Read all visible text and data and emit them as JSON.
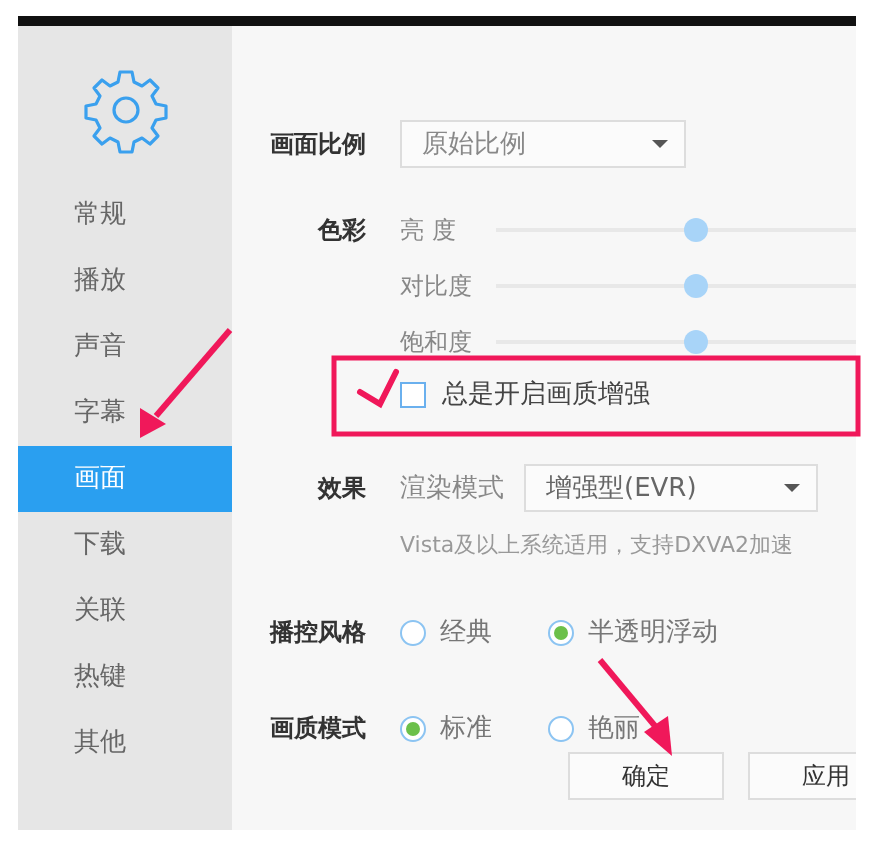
{
  "sidebar": {
    "items": [
      {
        "label": "常规",
        "selected": false
      },
      {
        "label": "播放",
        "selected": false
      },
      {
        "label": "声音",
        "selected": false
      },
      {
        "label": "字幕",
        "selected": false
      },
      {
        "label": "画面",
        "selected": true
      },
      {
        "label": "下载",
        "selected": false
      },
      {
        "label": "关联",
        "selected": false
      },
      {
        "label": "热键",
        "selected": false
      },
      {
        "label": "其他",
        "selected": false
      }
    ]
  },
  "aspect": {
    "label": "画面比例",
    "value": "原始比例"
  },
  "color": {
    "label": "色彩",
    "sliders": [
      {
        "label": "亮 度",
        "level": 0.5
      },
      {
        "label": "对比度",
        "level": 0.5
      },
      {
        "label": "饱和度",
        "level": 0.5
      }
    ]
  },
  "enhance": {
    "label": "总是开启画质增强",
    "checked": false
  },
  "effect": {
    "label": "效果",
    "sublabel": "渲染模式",
    "value": "增强型(EVR)",
    "hint": "Vista及以上系统适用，支持DXVA2加速"
  },
  "radio_groups": [
    {
      "label": "播控风格",
      "options": [
        {
          "label": "经典",
          "selected": false
        },
        {
          "label": "半透明浮动",
          "selected": true
        }
      ]
    },
    {
      "label": "画质模式",
      "options": [
        {
          "label": "标准",
          "selected": true
        },
        {
          "label": "艳丽",
          "selected": false
        }
      ]
    }
  ],
  "buttons": [
    "确定",
    "应用"
  ]
}
